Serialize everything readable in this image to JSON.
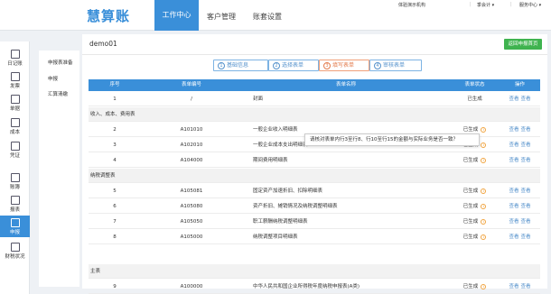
{
  "topbar": {
    "logo": "慧算账",
    "tabs": [
      "工作中心",
      "客户管理",
      "账套设置"
    ],
    "org": "体验演示机构",
    "term": "季会计 ▾",
    "service": "服务中心 ▾"
  },
  "sidenav": [
    "日记账",
    "发票",
    "单据",
    "成本",
    "凭证",
    "账簿",
    "报表",
    "申报",
    "财税状况"
  ],
  "submenu": [
    "申报表准备",
    "申报",
    "汇算清缴"
  ],
  "panel": {
    "company": "demo01",
    "back_button": "返回申报首页",
    "steps": [
      {
        "num": "1",
        "label": "基础信息"
      },
      {
        "num": "2",
        "label": "选择表单"
      },
      {
        "num": "3",
        "label": "填写表单"
      },
      {
        "num": "4",
        "label": "审核表单"
      }
    ]
  },
  "table": {
    "headers": [
      "序号",
      "表单编号",
      "表单名称",
      "表单状态",
      "操作"
    ],
    "groups": {
      "income": "收入、成本、费用表",
      "tax_adjust": "纳税调整表",
      "main": "主表"
    },
    "rows": [
      {
        "seq": "1",
        "code": "/",
        "name": "封面",
        "status": "已生成",
        "help": false
      },
      {
        "seq": "2",
        "code": "A101010",
        "name": "一般企业收入明细表",
        "status": "已生成",
        "help": true
      },
      {
        "seq": "3",
        "code": "A102010",
        "name": "一般企业成本支出明细表",
        "status": "已生成",
        "help": true
      },
      {
        "seq": "4",
        "code": "A104000",
        "name": "期间费用明细表",
        "status": "已生成",
        "help": true
      },
      {
        "seq": "5",
        "code": "A105081",
        "name": "固定资产加速折旧、扣除明细表",
        "status": "已生成",
        "help": true
      },
      {
        "seq": "6",
        "code": "A105080",
        "name": "资产折旧、摊销情况及纳税调整明细表",
        "status": "已生成",
        "help": true
      },
      {
        "seq": "7",
        "code": "A105050",
        "name": "职工薪酬纳税调整明细表",
        "status": "已生成",
        "help": true
      },
      {
        "seq": "8",
        "code": "A105000",
        "name": "纳税调整项目明细表",
        "status": "已生成",
        "help": true
      },
      {
        "seq": "9",
        "code": "A100000",
        "name": "中华人民共和国企业所得税年度纳税申报表(A类)",
        "status": "已生成",
        "help": true
      }
    ],
    "op_edit": "查看",
    "op_view": "查看",
    "help_glyph": "i"
  },
  "tooltip": "请核对表单内行3至行8、行10至行15的金额与实际业务是否一致？",
  "colors": {
    "accent": "#3a8fd9",
    "success": "#3fb34f",
    "warning": "#f0a440",
    "active_step": "#e37b4c"
  }
}
